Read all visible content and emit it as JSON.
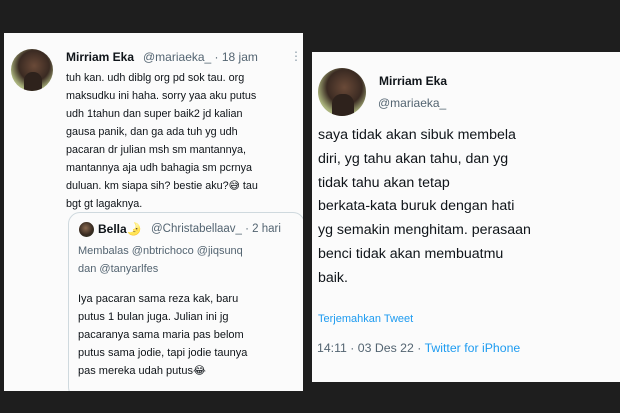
{
  "tweet_left": {
    "name": "Mirriam Eka",
    "handle_time": "@mariaeka_ · 18 jam",
    "more_label": "⋮",
    "text": "tuh kan. udh diblg org pd sok tau. org\nmaksudku ini haha. sorry yaa aku putus\nudh 1tahun dan super baik2 jd kalian\ngausa panik, dan ga ada tuh yg udh\npacaran dr julian msh sm mantannya,\nmantannya aja udh bahagia sm pcrnya\nduluan. km siapa sih? bestie aku?😅 tau\nbgt gt lagaknya.",
    "quote": {
      "name": "Bella🌛",
      "handle_time": "@Christabellaav_ · 2 hari",
      "reply_to": "Membalas @nbtrichoco @jiqsunq\ndan @tanyarlfes",
      "text": "Iya pacaran sama reza kak, baru\nputus 1 bulan juga. Julian ini jg\npacaranya sama maria pas belom\nputus sama jodie, tapi jodie taunya\npas mereka udah putus😂"
    }
  },
  "tweet_right": {
    "name": "Mirriam Eka",
    "handle": "@mariaeka_",
    "text": "saya tidak akan sibuk membela\ndiri, yg tahu akan tahu, dan yg\ntidak tahu akan tetap\nberkata-kata buruk dengan hati\nyg semakin menghitam. perasaan\nbenci tidak akan membuatmu\nbaik.",
    "translate_label": "Terjemahkan Tweet",
    "timestamp": "14:11 · 03 Des 22 · ",
    "source": "Twitter for iPhone"
  }
}
